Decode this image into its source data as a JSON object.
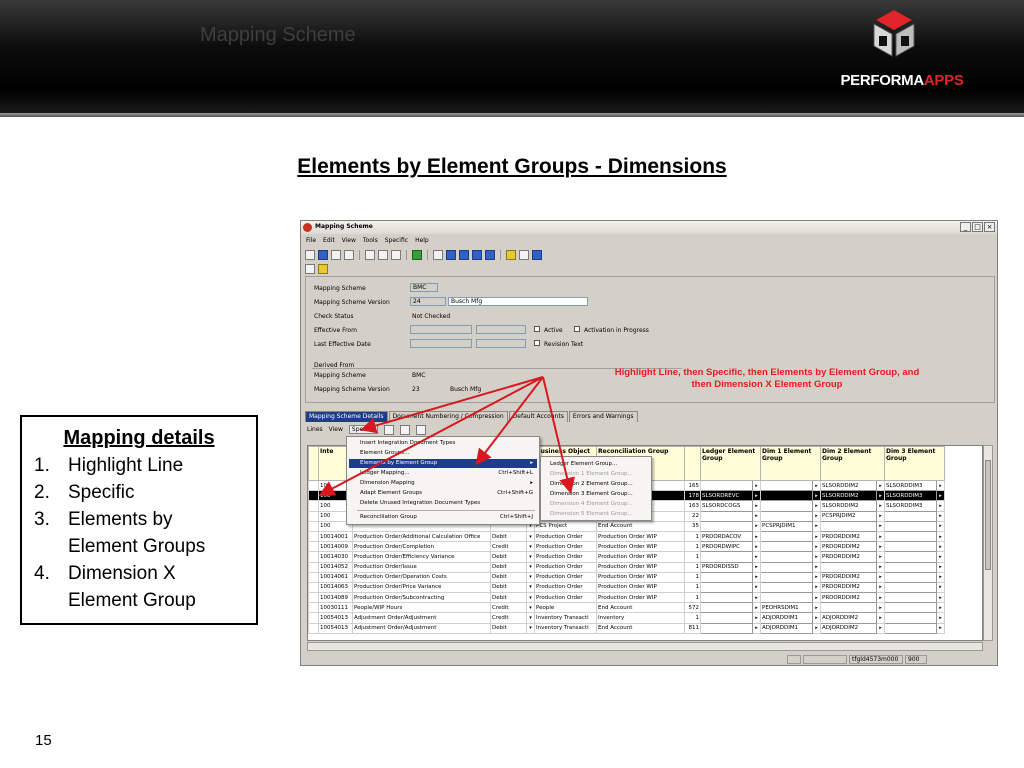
{
  "slide": {
    "header_title": "Mapping Scheme",
    "logo_text_white": "PERFORMA",
    "logo_text_red": "APPS",
    "heading": "Elements by Element Groups - Dimensions",
    "page_number": "15"
  },
  "notes": {
    "title": "Mapping details",
    "items": [
      {
        "num": "1.",
        "text": "Highlight Line"
      },
      {
        "num": "2.",
        "text": "Specific"
      },
      {
        "num": "3.",
        "text": "Elements by Element Groups"
      },
      {
        "num": "4.",
        "text": "Dimension X Element Group"
      }
    ]
  },
  "annotation": {
    "line1": "Highlight Line, then Specific, then Elements by Element Group, and",
    "line2": "then Dimension X Element Group",
    "color": "#e8181e"
  },
  "window": {
    "title": "Mapping Scheme",
    "menus": [
      "File",
      "Edit",
      "View",
      "Tools",
      "Specific",
      "Help"
    ],
    "form": {
      "mapping_scheme_label": "Mapping Scheme",
      "mapping_scheme_value": "BMC",
      "version_label": "Mapping Scheme Version",
      "version_value": "24",
      "version_desc": "Busch Mfg",
      "check_status_label": "Check Status",
      "check_status_value": "Not Checked",
      "effective_from_label": "Effective From",
      "last_effective_label": "Last Effective Date",
      "active_label": "Active",
      "activation_label": "Activation in Progress",
      "revision_label": "Revision Text",
      "derived_from_label": "Derived From",
      "derived_scheme_label": "Mapping Scheme",
      "derived_scheme_value": "BMC",
      "derived_version_label": "Mapping Scheme Version",
      "derived_version_value": "23",
      "derived_version_desc": "Busch Mfg"
    },
    "tabs": [
      "Mapping Scheme Details",
      "Document Numbering / Compression",
      "Default Accounts",
      "Errors and Warnings"
    ],
    "subbar": [
      "Lines",
      "View",
      "Specific"
    ],
    "grid": {
      "headers": [
        "Inte",
        "",
        "",
        "Business Object",
        "Reconciliation Group",
        "",
        "Ledger Element Group",
        "Dim 1 Element Group",
        "Dim 2 Element Group",
        "Dim 3 Element Group"
      ],
      "rows": [
        {
          "id": "100",
          "desc": "",
          "dc": "",
          "bo": "",
          "rg": "nt",
          "n": "165",
          "ledger": "",
          "d1": "",
          "d2": "SLSORDDIM2",
          "d3": "SLSORDDIM3",
          "sel": false
        },
        {
          "id": "100",
          "desc": "",
          "dc": "",
          "bo": "",
          "rg": "nt",
          "n": "178",
          "ledger": "SLSORDREVC",
          "d1": "",
          "d2": "SLSORDDIM2",
          "d3": "SLSORDDIM3",
          "sel": true
        },
        {
          "id": "100",
          "desc": "",
          "dc": "",
          "bo": "",
          "rg": "nt",
          "n": "163",
          "ledger": "SLSORDCOGS",
          "d1": "",
          "d2": "SLSORDDIM2",
          "d3": "SLSORDDIM3",
          "sel": false
        },
        {
          "id": "100",
          "desc": "",
          "dc": "",
          "bo": "",
          "rg": "nt",
          "n": "22",
          "ledger": "",
          "d1": "",
          "d2": "PCSPRJDIM2",
          "d3": "",
          "sel": false
        },
        {
          "id": "100",
          "desc": "",
          "dc": "",
          "bo": "PCS Project",
          "rg": "End Account",
          "n": "35",
          "ledger": "",
          "d1": "PCSPRJDIM1",
          "d2": "",
          "d3": "",
          "sel": false
        },
        {
          "id": "10014001",
          "desc": "Production Order/Additional Calculation Office",
          "dc": "Debit",
          "bo": "Production Order",
          "rg": "Production Order WIP",
          "n": "1",
          "ledger": "PRDORDACOV",
          "d1": "",
          "d2": "PRDORDDIM2",
          "d3": "",
          "sel": false
        },
        {
          "id": "10014009",
          "desc": "Production Order/Completion",
          "dc": "Credit",
          "bo": "Production Order",
          "rg": "Production Order WIP",
          "n": "1",
          "ledger": "PRDORDWIPC",
          "d1": "",
          "d2": "PRDORDDIM2",
          "d3": "",
          "sel": false
        },
        {
          "id": "10014030",
          "desc": "Production Order/Efficiency Variance",
          "dc": "Debit",
          "bo": "Production Order",
          "rg": "Production Order WIP",
          "n": "1",
          "ledger": "",
          "d1": "",
          "d2": "PRDORDDIM2",
          "d3": "",
          "sel": false
        },
        {
          "id": "10014052",
          "desc": "Production Order/Issue",
          "dc": "Debit",
          "bo": "Production Order",
          "rg": "Production Order WIP",
          "n": "1",
          "ledger": "PRDORDISSD",
          "d1": "",
          "d2": "",
          "d3": "",
          "sel": false
        },
        {
          "id": "10014061",
          "desc": "Production Order/Operation Costs",
          "dc": "Debit",
          "bo": "Production Order",
          "rg": "Production Order WIP",
          "n": "1",
          "ledger": "",
          "d1": "",
          "d2": "PRDORDDIM2",
          "d3": "",
          "sel": false
        },
        {
          "id": "10014063",
          "desc": "Production Order/Price Variance",
          "dc": "Debit",
          "bo": "Production Order",
          "rg": "Production Order WIP",
          "n": "1",
          "ledger": "",
          "d1": "",
          "d2": "PRDORDDIM2",
          "d3": "",
          "sel": false
        },
        {
          "id": "10014089",
          "desc": "Production Order/Subcontracting",
          "dc": "Debit",
          "bo": "Production Order",
          "rg": "Production Order WIP",
          "n": "1",
          "ledger": "",
          "d1": "",
          "d2": "PRDORDDIM2",
          "d3": "",
          "sel": false
        },
        {
          "id": "10030111",
          "desc": "People/WIP Hours",
          "dc": "Credit",
          "bo": "People",
          "rg": "End Account",
          "n": "572",
          "ledger": "",
          "d1": "PEOHRSDIM1",
          "d2": "",
          "d3": "",
          "sel": false
        },
        {
          "id": "10054013",
          "desc": "Adjustment Order/Adjustment",
          "dc": "Credit",
          "bo": "Inventory Transacti",
          "rg": "Inventory",
          "n": "1",
          "ledger": "",
          "d1": "ADJORDDIM1",
          "d2": "ADJORDDIM2",
          "d3": "",
          "sel": false
        },
        {
          "id": "10054013",
          "desc": "Adjustment Order/Adjustment",
          "dc": "Debit",
          "bo": "Inventory Transacti",
          "rg": "End Account",
          "n": "811",
          "ledger": "",
          "d1": "ADJORDDIM1",
          "d2": "ADJORDDIM2",
          "d3": "",
          "sel": false
        }
      ]
    },
    "status": [
      "tfgld4573m000",
      "900"
    ],
    "context_menu": [
      {
        "label": "Insert Integration Document Types",
        "shortcut": ""
      },
      {
        "label": "Element Groups...",
        "shortcut": ""
      },
      {
        "label": "Elements by Element Group",
        "shortcut": "",
        "highlighted": true
      },
      {
        "label": "Ledger Mapping...",
        "shortcut": "Ctrl+Shift+L"
      },
      {
        "label": "Dimension Mapping",
        "shortcut": ""
      },
      {
        "label": "Adapt Element Groups",
        "shortcut": "Ctrl+Shift+G"
      },
      {
        "label": "Delete Unused Integration Document Types",
        "shortcut": ""
      },
      {
        "label": "Reconciliation Group",
        "shortcut": "Ctrl+Shift+J"
      }
    ],
    "submenu": [
      {
        "label": "Ledger Element Group...",
        "disabled": false
      },
      {
        "label": "Dimension 1 Element Group...",
        "disabled": true
      },
      {
        "label": "Dimension 2 Element Group...",
        "disabled": false
      },
      {
        "label": "Dimension 3 Element Group...",
        "disabled": false
      },
      {
        "label": "Dimension 4 Element Group...",
        "disabled": true
      },
      {
        "label": "Dimension 5 Element Group...",
        "disabled": true
      }
    ]
  }
}
